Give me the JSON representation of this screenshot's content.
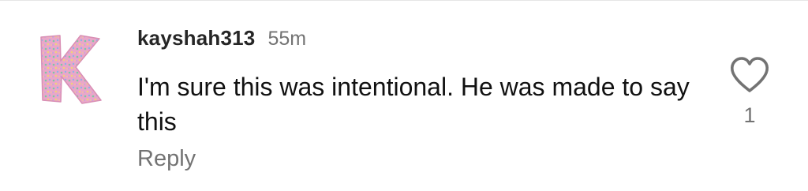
{
  "comment": {
    "avatar_icon": "letter-k-avatar-icon",
    "username": "kayshah313",
    "timestamp": "55m",
    "text": "I'm sure this was intentional. He was made to say this",
    "reply_label": "Reply",
    "like_icon": "heart-outline-icon",
    "like_count": "1"
  },
  "colors": {
    "username": "#262626",
    "secondary_text": "#737373",
    "body_text": "#111111",
    "icon_stroke": "#737373",
    "avatar_pink": "#e9a7c9",
    "avatar_sprinkle_green": "#7fc7a3",
    "avatar_sprinkle_blue": "#8fb1e8",
    "avatar_sprinkle_yellow": "#f1d27a"
  }
}
